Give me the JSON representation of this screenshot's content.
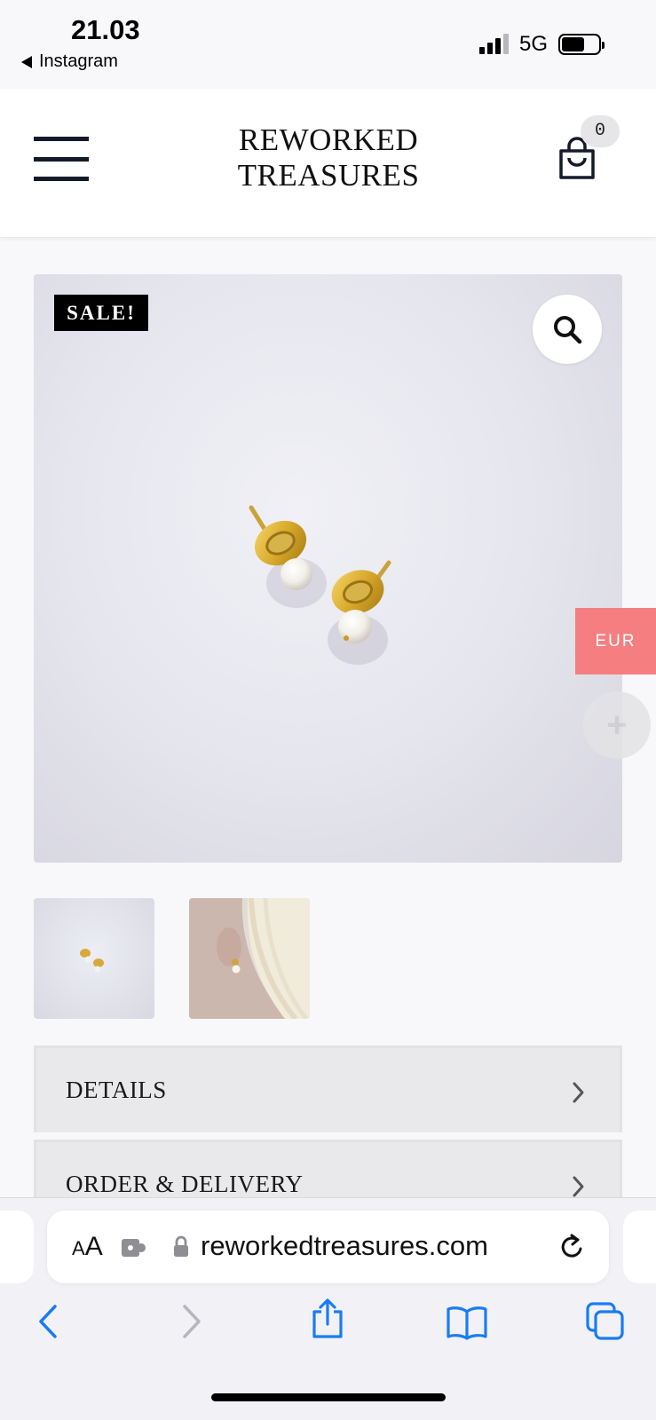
{
  "status_bar": {
    "time": "21.03",
    "back_app": "Instagram",
    "network": "5G",
    "signal_bars_active": 3,
    "signal_bars_total": 4,
    "battery_level": 0.62
  },
  "header": {
    "logo_line1": "REWORKED",
    "logo_line2": "TREASURES",
    "cart_count": "0"
  },
  "product": {
    "sale_badge": "SALE!",
    "main_image_icon": "pearl-earrings-image",
    "thumbnails": [
      "earrings-on-white-thumbnail",
      "earring-worn-on-ear-thumbnail"
    ]
  },
  "floating": {
    "currency": "EUR"
  },
  "accordion": {
    "items": [
      {
        "label": "DETAILS"
      },
      {
        "label": "ORDER & DELIVERY"
      }
    ]
  },
  "browser": {
    "aa_label_small": "A",
    "aa_label_large": "A",
    "url": "reworkedtreasures.com"
  },
  "colors": {
    "accent_currency": "#f57f80",
    "safari_blue": "#1a7cf5",
    "header_text": "#111111",
    "image_bg": "#e6e6ee"
  }
}
